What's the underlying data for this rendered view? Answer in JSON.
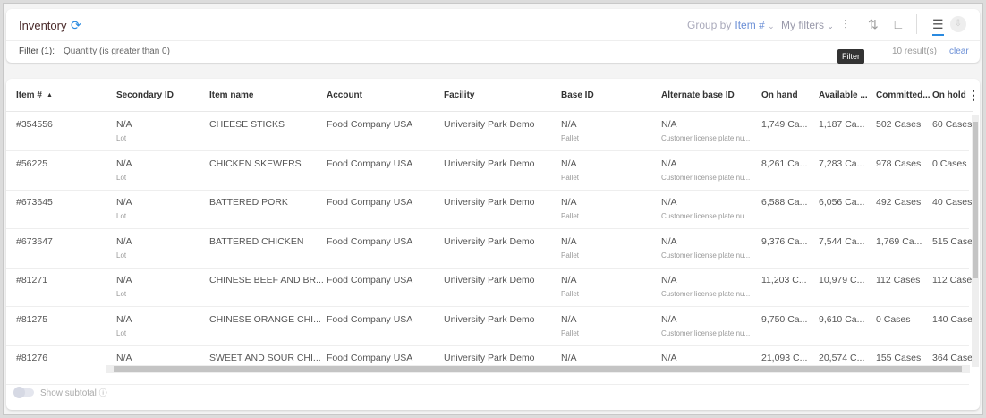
{
  "header": {
    "title": "Inventory",
    "group_by_label": "Group by",
    "group_by_value": "Item #",
    "my_filters": "My filters",
    "tooltip": "Filter",
    "filter_label": "Filter (1):",
    "filter_value": "Quantity (is greater than 0)",
    "results": "10 result(s)",
    "clear": "clear"
  },
  "icons": [
    "refresh-icon",
    "filter-icon",
    "sort-icon",
    "columns-icon",
    "list-view-icon",
    "download-icon"
  ],
  "accent": "#6b8fd6",
  "table": {
    "columns": [
      "Item #",
      "Secondary ID",
      "Item name",
      "Account",
      "Facility",
      "Base ID",
      "Alternate base ID",
      "On hand",
      "Available ...",
      "Committed...",
      "On hold"
    ],
    "rows": [
      [
        "#354556",
        "N/A",
        "Lot",
        "CHEESE STICKS",
        "Food Company USA",
        "University Park Demo",
        "N/A",
        "Pallet",
        "N/A",
        "Customer license plate nu...",
        "1,749 Ca...",
        "1,187 Ca...",
        "502 Cases",
        "60 Cases"
      ],
      [
        "#56225",
        "N/A",
        "Lot",
        "CHICKEN SKEWERS",
        "Food Company USA",
        "University Park Demo",
        "N/A",
        "Pallet",
        "N/A",
        "Customer license plate nu...",
        "8,261 Ca...",
        "7,283 Ca...",
        "978 Cases",
        "0 Cases"
      ],
      [
        "#673645",
        "N/A",
        "Lot",
        "BATTERED PORK",
        "Food Company USA",
        "University Park Demo",
        "N/A",
        "Pallet",
        "N/A",
        "Customer license plate nu...",
        "6,588 Ca...",
        "6,056 Ca...",
        "492 Cases",
        "40 Cases"
      ],
      [
        "#673647",
        "N/A",
        "Lot",
        "BATTERED CHICKEN",
        "Food Company USA",
        "University Park Demo",
        "N/A",
        "Pallet",
        "N/A",
        "Customer license plate nu...",
        "9,376 Ca...",
        "7,544 Ca...",
        "1,769 Ca...",
        "515 Case"
      ],
      [
        "#81271",
        "N/A",
        "Lot",
        "CHINESE BEEF AND BR...",
        "Food Company USA",
        "University Park Demo",
        "N/A",
        "Pallet",
        "N/A",
        "Customer license plate nu...",
        "11,203 C...",
        "10,979 C...",
        "112 Cases",
        "112 Case"
      ],
      [
        "#81275",
        "N/A",
        "Lot",
        "CHINESE ORANGE CHI...",
        "Food Company USA",
        "University Park Demo",
        "N/A",
        "Pallet",
        "N/A",
        "Customer license plate nu...",
        "9,750 Ca...",
        "9,610 Ca...",
        "0 Cases",
        "140 Case"
      ],
      [
        "#81276",
        "N/A",
        "",
        "SWEET AND SOUR CHI...",
        "Food Company USA",
        "University Park Demo",
        "N/A",
        "",
        "N/A",
        "",
        "21,093 C...",
        "20,574 C...",
        "155 Cases",
        "364 Case"
      ]
    ]
  },
  "footer": {
    "show_subtotal": "Show subtotal"
  }
}
